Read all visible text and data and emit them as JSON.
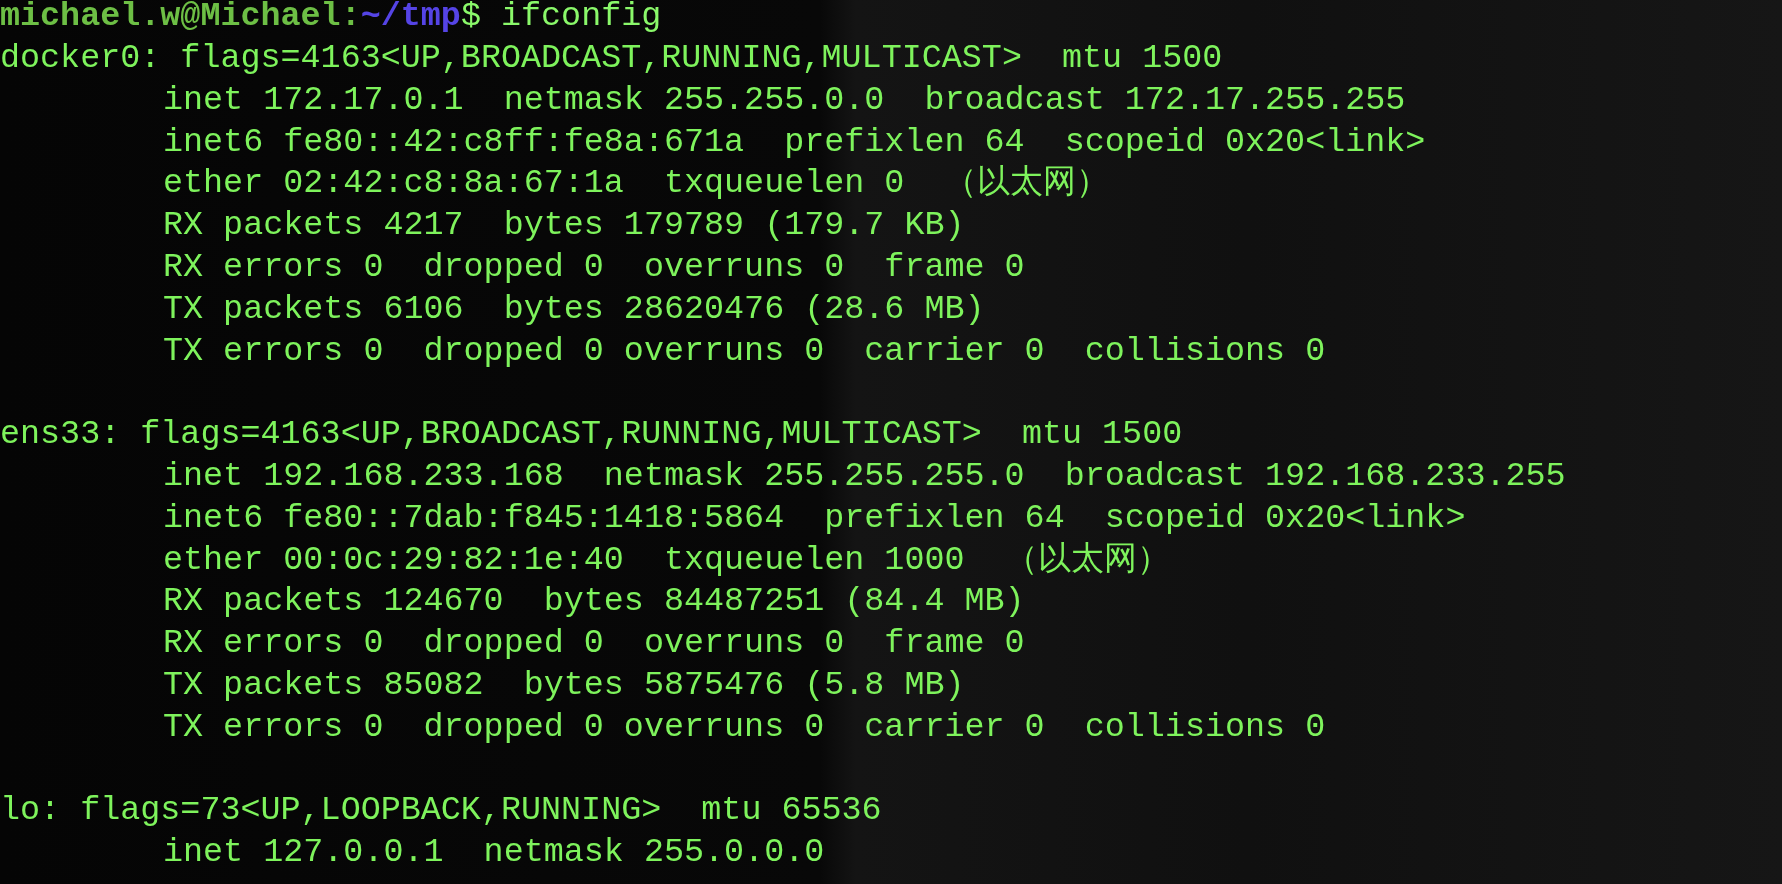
{
  "prompt": {
    "user_host": "michael.w@Michael:",
    "path": "~/tmp",
    "symbol": "$",
    "command": "ifconfig"
  },
  "interfaces": [
    {
      "header": "docker0: flags=4163<UP,BROADCAST,RUNNING,MULTICAST>  mtu 1500",
      "lines": [
        "inet 172.17.0.1  netmask 255.255.0.0  broadcast 172.17.255.255",
        "inet6 fe80::42:c8ff:fe8a:671a  prefixlen 64  scopeid 0x20<link>",
        "ether 02:42:c8:8a:67:1a  txqueuelen 0  （以太网）",
        "RX packets 4217  bytes 179789 (179.7 KB)",
        "RX errors 0  dropped 0  overruns 0  frame 0",
        "TX packets 6106  bytes 28620476 (28.6 MB)",
        "TX errors 0  dropped 0 overruns 0  carrier 0  collisions 0"
      ]
    },
    {
      "header": "ens33: flags=4163<UP,BROADCAST,RUNNING,MULTICAST>  mtu 1500",
      "lines": [
        "inet 192.168.233.168  netmask 255.255.255.0  broadcast 192.168.233.255",
        "inet6 fe80::7dab:f845:1418:5864  prefixlen 64  scopeid 0x20<link>",
        "ether 00:0c:29:82:1e:40  txqueuelen 1000  （以太网）",
        "RX packets 124670  bytes 84487251 (84.4 MB)",
        "RX errors 0  dropped 0  overruns 0  frame 0",
        "TX packets 85082  bytes 5875476 (5.8 MB)",
        "TX errors 0  dropped 0 overruns 0  carrier 0  collisions 0"
      ]
    },
    {
      "header": "lo: flags=73<UP,LOOPBACK,RUNNING>  mtu 65536",
      "lines": [
        "inet 127.0.0.1  netmask 255.0.0.0"
      ]
    }
  ]
}
